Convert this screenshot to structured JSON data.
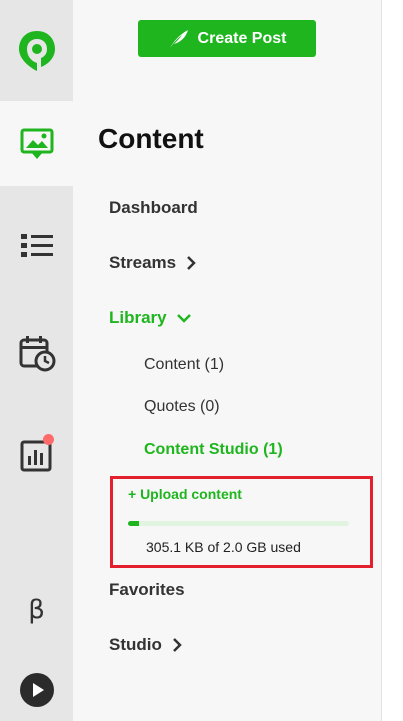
{
  "rail": {
    "items": [
      {
        "icon": "pin-logo-icon"
      },
      {
        "icon": "content-image-icon",
        "active": true
      },
      {
        "icon": "list-icon"
      },
      {
        "icon": "calendar-clock-icon"
      },
      {
        "icon": "analytics-icon",
        "notification": true
      },
      {
        "icon": "beta-icon",
        "label": "β"
      },
      {
        "icon": "play-icon"
      }
    ]
  },
  "header": {
    "create_button": "Create Post"
  },
  "main": {
    "title": "Content",
    "nav": {
      "dashboard": "Dashboard",
      "streams": "Streams",
      "library": "Library",
      "favorites": "Favorites",
      "studio": "Studio"
    },
    "library_items": {
      "content": "Content (1)",
      "quotes": "Quotes (0)",
      "content_studio": "Content Studio (1)"
    },
    "upload": {
      "link": "+ Upload content",
      "usage": "305.1 KB of 2.0 GB used",
      "used_fraction": 0.05
    }
  },
  "colors": {
    "accent": "#1fb51f",
    "highlight": "#e5202e",
    "badge": "#ff6b6b"
  }
}
